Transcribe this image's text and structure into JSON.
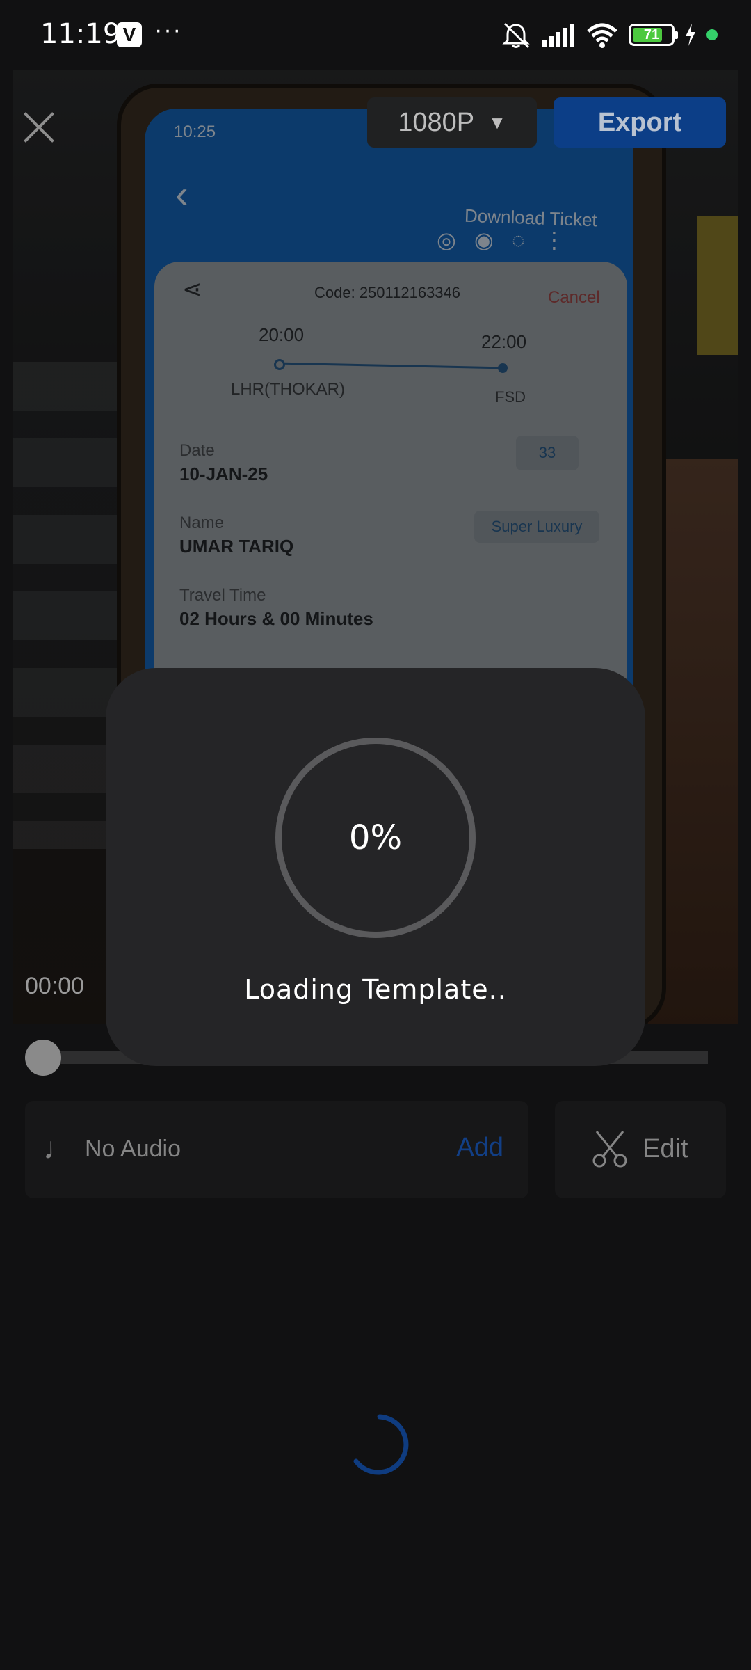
{
  "status_bar": {
    "time": "11:19",
    "app_badge": "V",
    "more": "···",
    "battery_level": "71"
  },
  "preview": {
    "phone_time": "10:25",
    "download_label": "Download Ticket",
    "ticket": {
      "code": "Code: 250112163346",
      "cancel": "Cancel",
      "dep_time": "20:00",
      "arr_time": "22:00",
      "from": "LHR(THOKAR)",
      "to": "FSD",
      "date_label": "Date",
      "date_value": "10-JAN-25",
      "seat": "33",
      "name_label": "Name",
      "name_value": "UMAR TARIQ",
      "class": "Super Luxury",
      "travel_label": "Travel Time",
      "travel_value": "02 Hours & 00 Minutes"
    }
  },
  "top_controls": {
    "resolution": "1080P",
    "export": "Export"
  },
  "playback": {
    "time": "00:00",
    "position": 0
  },
  "audio": {
    "label": "No Audio",
    "add": "Add"
  },
  "edit": {
    "label": "Edit"
  },
  "dialog": {
    "progress": "0%",
    "message": "Loading Template.."
  },
  "colors": {
    "accent": "#0c3e87",
    "background": "#111112",
    "dialog": "#252527"
  }
}
